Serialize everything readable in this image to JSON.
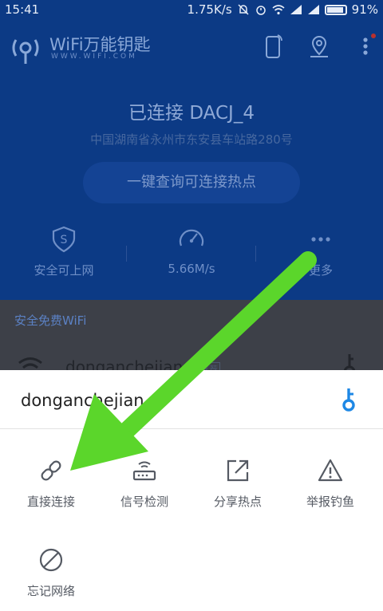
{
  "status_bar": {
    "time": "15:41",
    "net_speed": "1.75K/s",
    "battery": "91%"
  },
  "header": {
    "brand": "WiFi万能钥匙",
    "brand_sub": "WWW.WIFI.COM",
    "icons": [
      "phone-icon",
      "location-pin-icon",
      "more-vertical-icon"
    ]
  },
  "status": {
    "connected": "已连接 DACJ_4",
    "location": "中国湖南省永州市东安县车站路280号",
    "query_button": "一键查询可连接热点"
  },
  "stats": [
    {
      "icon": "shield-icon",
      "label": "安全可上网"
    },
    {
      "icon": "speedometer-icon",
      "label": "5.66M/s"
    },
    {
      "icon": "more-dots-icon",
      "label": "更多"
    }
  ],
  "section": {
    "title": "安全免费WiFi",
    "network_name": "dongancheijan",
    "network_tag": "推荐"
  },
  "sheet": {
    "title": "donganchejian",
    "actions": [
      {
        "icon": "link-icon",
        "label": "直接连接"
      },
      {
        "icon": "router-icon",
        "label": "信号检测"
      },
      {
        "icon": "share-icon",
        "label": "分享热点"
      },
      {
        "icon": "warning-icon",
        "label": "举报钓鱼"
      },
      {
        "icon": "forbidden-icon",
        "label": "忘记网络"
      }
    ]
  },
  "colors": {
    "app_blue": "#0c3a85",
    "dim_overlay_section": "#3d4048",
    "accent": "#1e88e5",
    "arrow_green": "#5bd62b"
  }
}
